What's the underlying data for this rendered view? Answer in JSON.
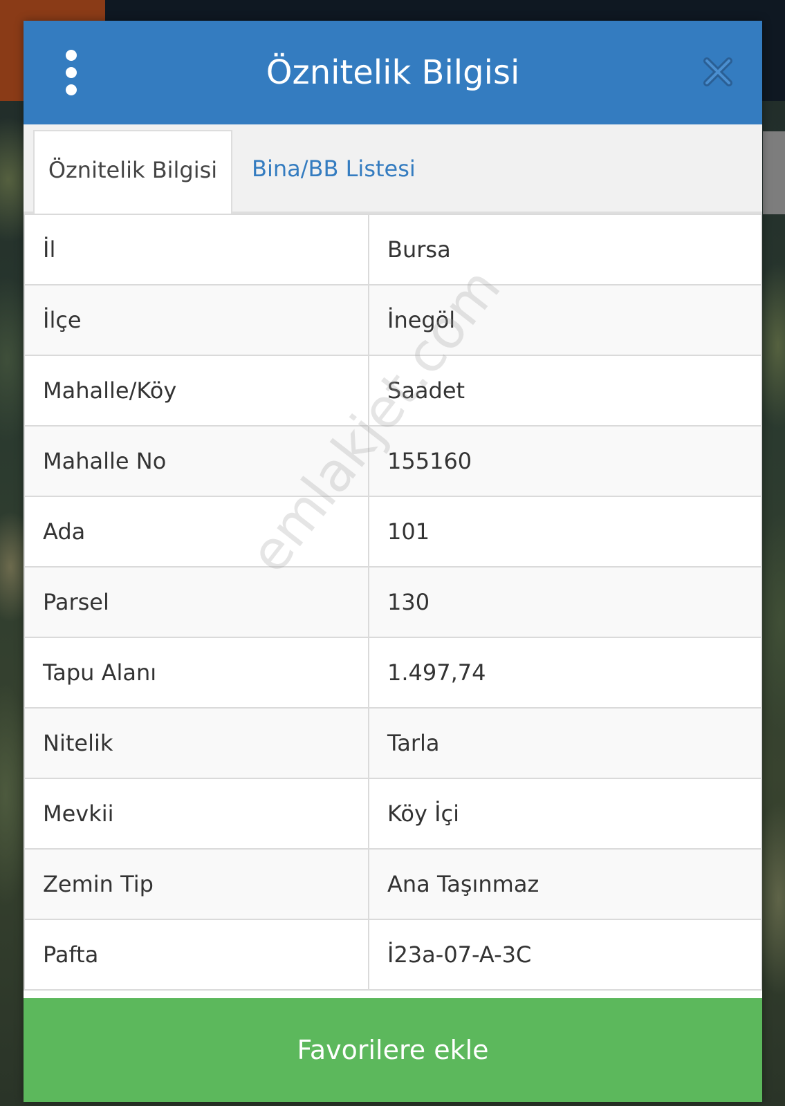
{
  "dialog": {
    "title": "Öznitelik Bilgisi",
    "menu_icon": "more-vertical-icon",
    "close_icon": "close-icon"
  },
  "tabs": [
    {
      "label": "Öznitelik Bilgisi",
      "active": true
    },
    {
      "label": "Bina/BB Listesi",
      "active": false
    }
  ],
  "attributes": [
    {
      "key": "İl",
      "value": "Bursa"
    },
    {
      "key": "İlçe",
      "value": "İnegöl"
    },
    {
      "key": "Mahalle/Köy",
      "value": "Saadet"
    },
    {
      "key": "Mahalle No",
      "value": "155160"
    },
    {
      "key": "Ada",
      "value": "101"
    },
    {
      "key": "Parsel",
      "value": "130"
    },
    {
      "key": "Tapu Alanı",
      "value": "1.497,74"
    },
    {
      "key": "Nitelik",
      "value": "Tarla"
    },
    {
      "key": "Mevkii",
      "value": "Köy İçi"
    },
    {
      "key": "Zemin Tip",
      "value": "Ana Taşınmaz"
    },
    {
      "key": "Pafta",
      "value": "İ23a-07-A-3C"
    }
  ],
  "watermark": "emlakjet.com",
  "footer": {
    "favorite_label": "Favorilere ekle"
  },
  "colors": {
    "header": "#347cc0",
    "tab_link": "#347cc0",
    "favorite_button": "#5cb85c"
  }
}
